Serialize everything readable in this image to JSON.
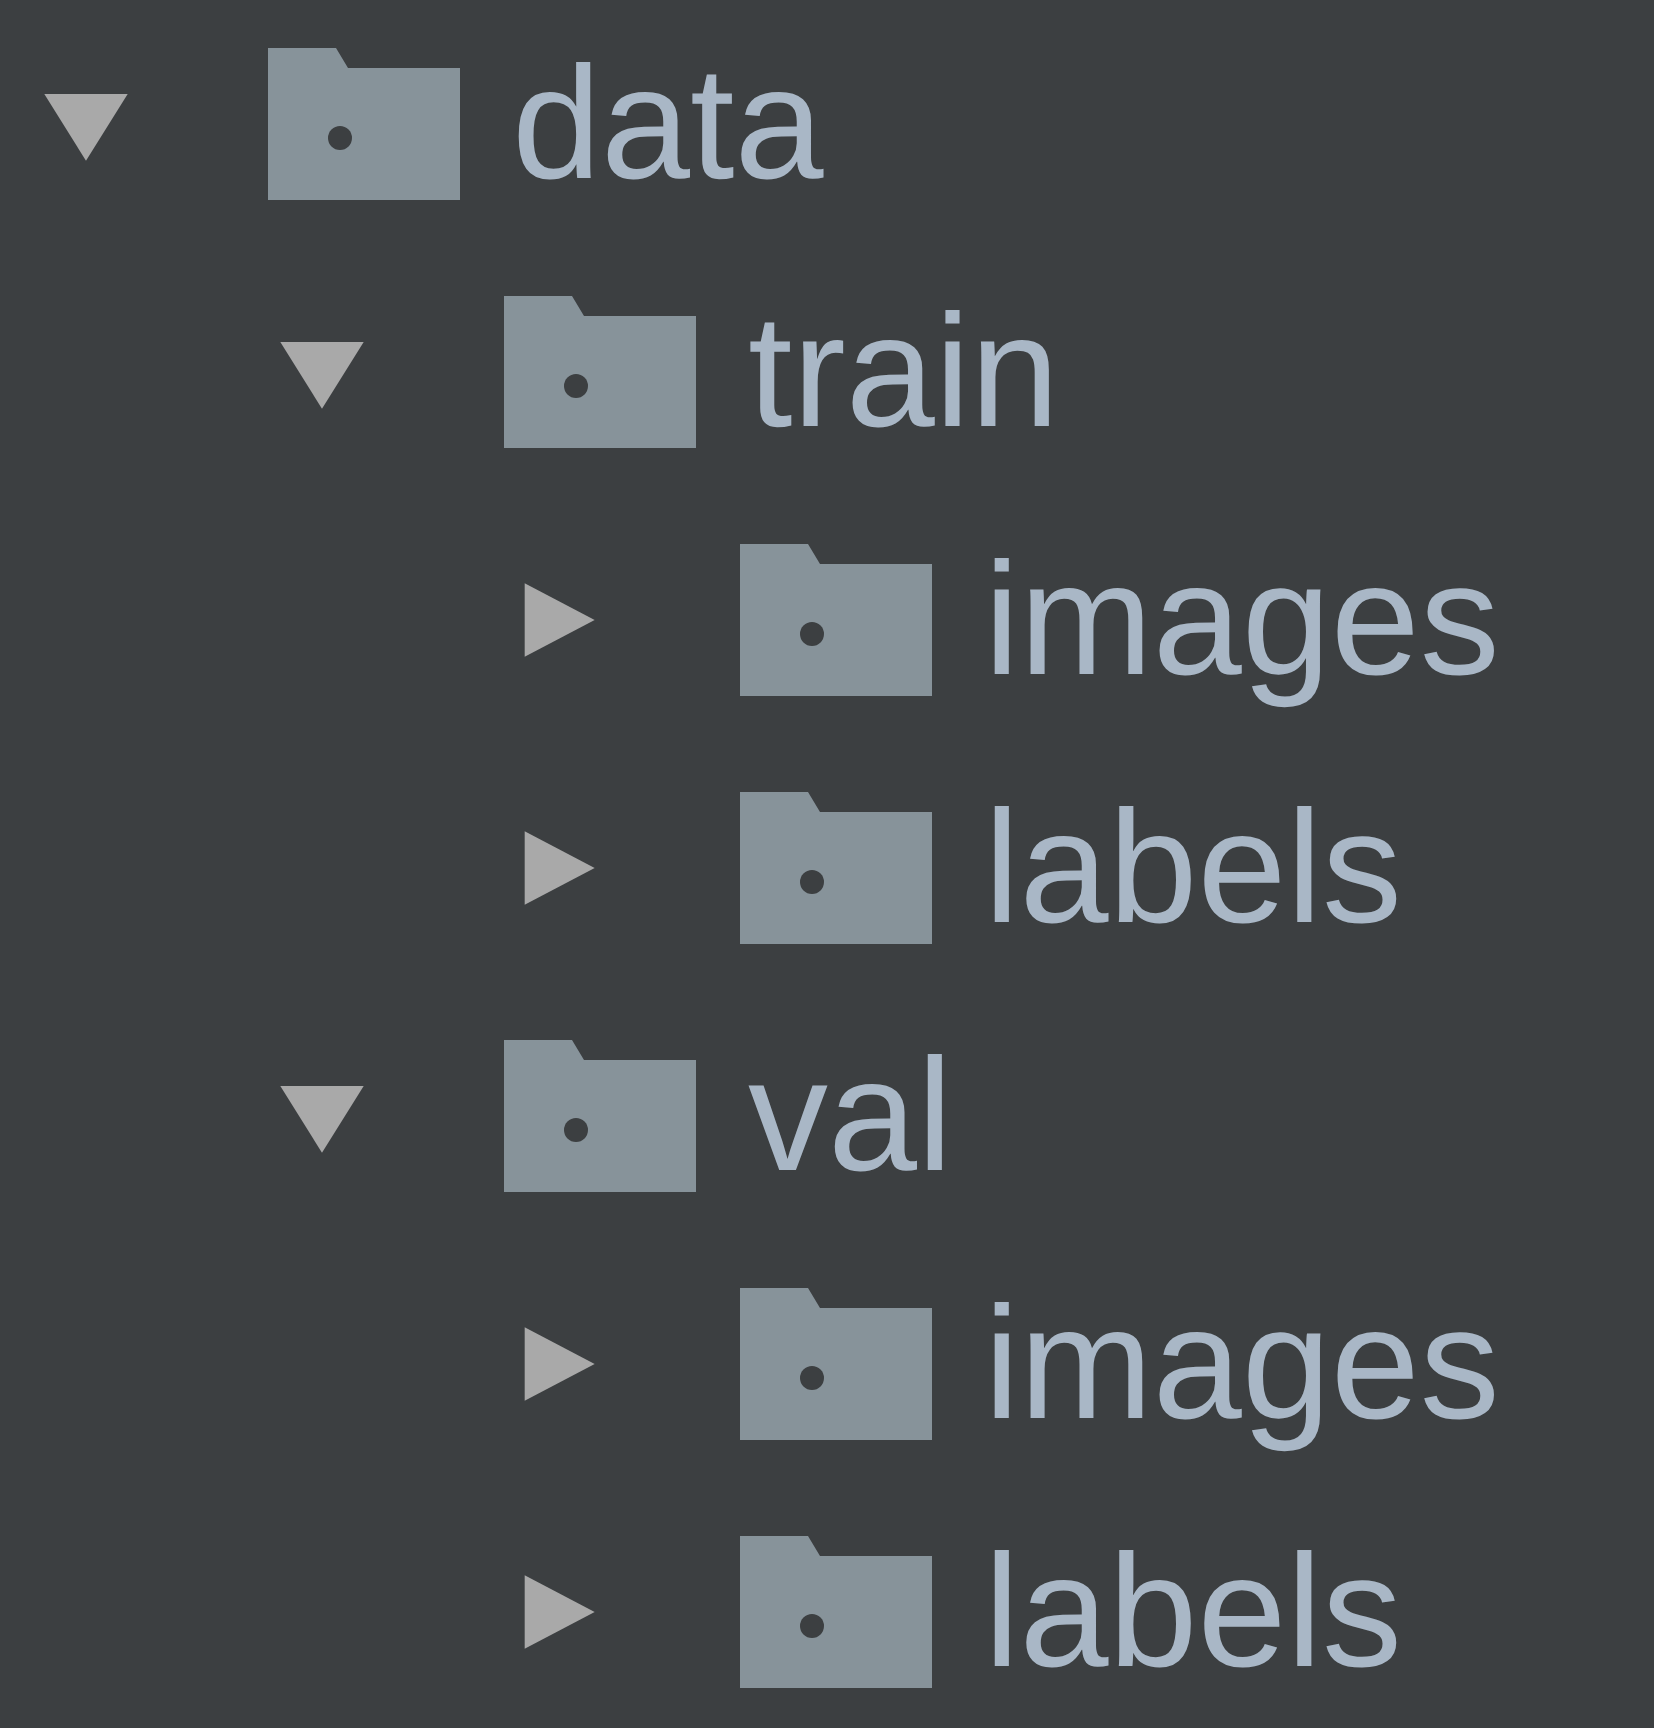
{
  "tree": [
    {
      "label": "data",
      "expanded": true,
      "children": [
        {
          "label": "train",
          "expanded": true,
          "children": [
            {
              "label": "images",
              "expanded": false
            },
            {
              "label": "labels",
              "expanded": false
            }
          ]
        },
        {
          "label": "val",
          "expanded": true,
          "children": [
            {
              "label": "images",
              "expanded": false
            },
            {
              "label": "labels",
              "expanded": false
            }
          ]
        }
      ]
    }
  ]
}
